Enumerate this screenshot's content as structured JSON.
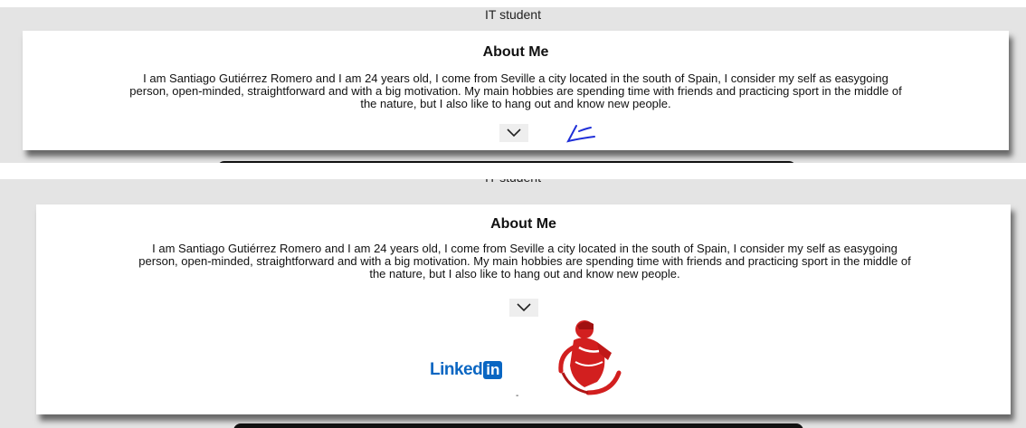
{
  "profile": {
    "subtitle": "IT student",
    "about_title": "About Me",
    "about_text": "I am Santiago Gutiérrez Romero and I am 24 years old, I come from Seville a city located in the south of Spain, I consider my self as easygoing person, open-minded, straightforward and with a big motivation. My main hobbies are spending time with friends and practicing sport in the middle of the nature, but I also like to hang out and know new people."
  },
  "social": {
    "linkedin_word": "Linked",
    "linkedin_box": "in",
    "separator": "-"
  },
  "icons": {
    "toggle": "chevron-down-icon",
    "annotation": "pen-scribble-icon",
    "mascot": "red-figure-logo-icon"
  },
  "colors": {
    "page_bg": "#e4e4e4",
    "card_bg": "#ffffff",
    "linkedin": "#0a66c2",
    "mascot": "#d21f1f",
    "scribble": "#1f2fd8"
  }
}
